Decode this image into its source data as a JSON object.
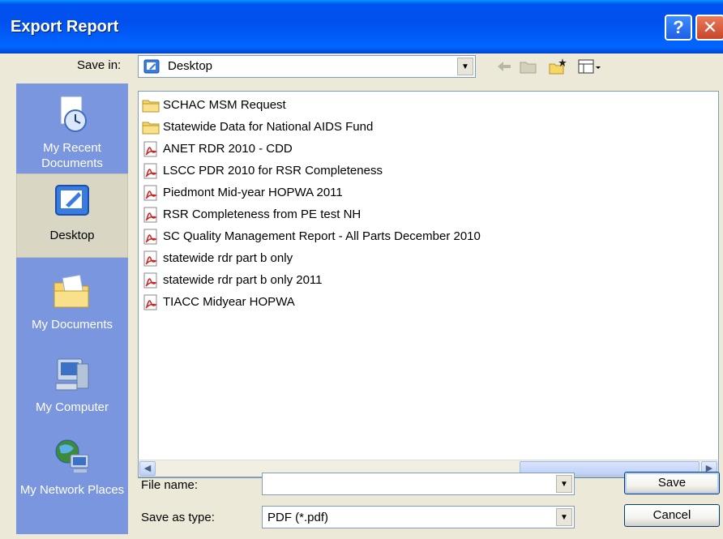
{
  "window": {
    "title": "Export Report",
    "help_label": "?",
    "close_label": "✕"
  },
  "save_in": {
    "label": "Save in:",
    "value": "Desktop"
  },
  "places": [
    {
      "label": "My Recent Documents",
      "icon": "recent-documents-icon"
    },
    {
      "label": "Desktop",
      "icon": "desktop-icon",
      "selected": true
    },
    {
      "label": "My Documents",
      "icon": "my-documents-icon"
    },
    {
      "label": "My Computer",
      "icon": "my-computer-icon"
    },
    {
      "label": "My Network Places",
      "icon": "network-places-icon"
    }
  ],
  "files": [
    {
      "name": "SCHAC MSM Request",
      "type": "folder"
    },
    {
      "name": "Statewide Data for National AIDS Fund",
      "type": "folder"
    },
    {
      "name": "ANET RDR 2010 - CDD",
      "type": "pdf"
    },
    {
      "name": "LSCC PDR 2010 for RSR Completeness",
      "type": "pdf"
    },
    {
      "name": "Piedmont Mid-year HOPWA 2011",
      "type": "pdf"
    },
    {
      "name": "RSR Completeness from PE test NH",
      "type": "pdf"
    },
    {
      "name": "SC Quality Management Report - All Parts December 2010",
      "type": "pdf"
    },
    {
      "name": "statewide rdr part b only",
      "type": "pdf"
    },
    {
      "name": "statewide rdr part b only 2011",
      "type": "pdf"
    },
    {
      "name": "TIACC Midyear HOPWA",
      "type": "pdf"
    }
  ],
  "file_name": {
    "label": "File name:",
    "value": ""
  },
  "save_as_type": {
    "label": "Save as type:",
    "value": "PDF (*.pdf)"
  },
  "buttons": {
    "save": "Save",
    "cancel": "Cancel"
  },
  "scrollbar": {
    "left_arrow": "◀",
    "right_arrow": "▶"
  },
  "colors": {
    "titlebar": "#0053EE",
    "places_bar": "#7A96DF",
    "dialog_bg": "#ECE9D8"
  }
}
